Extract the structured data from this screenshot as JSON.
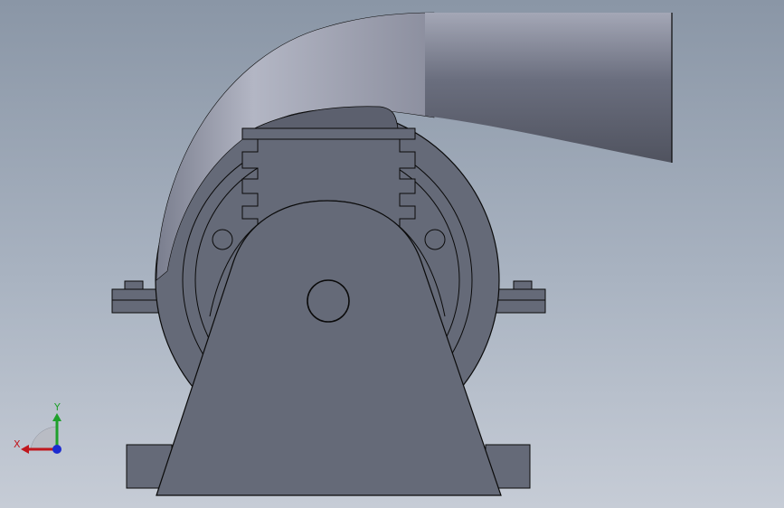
{
  "viewport": {
    "colors": {
      "background_top": "#8a96a6",
      "background_bottom": "#c6ccd6",
      "part_fill": "#656a78",
      "part_edge": "#0a0a0a",
      "duct_light": "#a7aab8",
      "duct_dark": "#525564"
    }
  },
  "triad": {
    "x_label": "X",
    "y_label": "Y",
    "x_color": "#c0171d",
    "y_color": "#1fa02b",
    "z_color": "#1c2bd0"
  }
}
